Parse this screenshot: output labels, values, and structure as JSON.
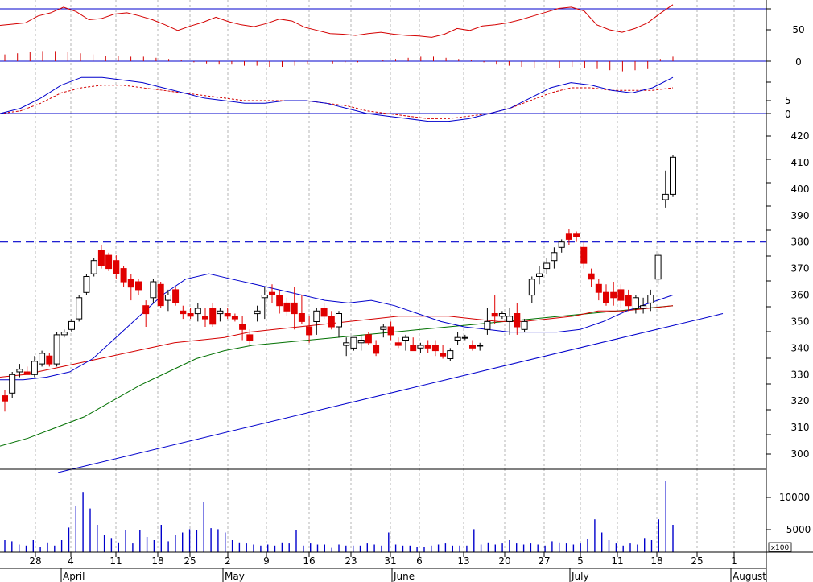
{
  "chart_data": [
    {
      "type": "line",
      "panel": "rsi",
      "yticks": [
        50,
        0
      ],
      "grid": true,
      "series": [
        {
          "color": "#d40000",
          "values": [
            57,
            59,
            61,
            72,
            77,
            86,
            79,
            66,
            68,
            75,
            77,
            72,
            66,
            58,
            49,
            56,
            62,
            70,
            63,
            58,
            55,
            60,
            67,
            64,
            54,
            49,
            44,
            43,
            41,
            44,
            46,
            43,
            41,
            40,
            38,
            43,
            52,
            49,
            56,
            58,
            61,
            66,
            72,
            78,
            84,
            86,
            80,
            58,
            50,
            46,
            52,
            61,
            76,
            90
          ]
        },
        {
          "name": "",
          "color": "#d40000",
          "bars": true,
          "values": [
            12,
            14,
            16,
            18,
            18,
            16,
            14,
            12,
            10,
            10,
            8,
            8,
            6,
            4,
            2,
            -2,
            -4,
            -6,
            -6,
            -8,
            -8,
            -10,
            -10,
            -8,
            -6,
            -4,
            -4,
            -2,
            -2,
            0,
            2,
            4,
            6,
            8,
            8,
            6,
            4,
            2,
            -2,
            -6,
            -8,
            -10,
            -12,
            -14,
            -12,
            -10,
            -12,
            -14,
            -16,
            -18,
            -16,
            -14,
            4,
            8
          ]
        }
      ]
    },
    {
      "type": "line",
      "panel": "macd",
      "yticks": [
        5,
        0
      ],
      "series": [
        {
          "color": "#0000cc",
          "values": [
            0,
            2,
            6,
            11,
            14,
            14,
            13,
            12,
            10,
            8,
            6,
            5,
            4,
            4,
            5,
            5,
            4,
            2,
            0,
            -1,
            -2,
            -3,
            -3,
            -2,
            0,
            2,
            6,
            10,
            12,
            11,
            9,
            8,
            10,
            14
          ]
        },
        {
          "color": "#d40000",
          "dashed": true,
          "values": [
            0,
            1,
            4,
            8,
            10,
            11,
            11,
            10,
            9,
            8,
            7,
            6,
            5,
            5,
            5,
            5,
            4,
            3,
            1,
            0,
            -1,
            -2,
            -2,
            -1,
            0,
            2,
            5,
            8,
            10,
            10,
            9,
            9,
            9,
            10
          ]
        }
      ]
    },
    {
      "type": "candlestick",
      "panel": "price",
      "yticks": [
        300,
        310,
        320,
        330,
        340,
        350,
        360,
        370,
        380,
        390,
        400,
        410,
        420
      ],
      "ylim": [
        294,
        424
      ],
      "reference_level": 380,
      "x_ticks": [
        "28",
        "4",
        "11",
        "18",
        "25",
        "2",
        "9",
        "16",
        "23",
        "31",
        "6",
        "13",
        "20",
        "27",
        "5",
        "11",
        "18",
        "25",
        "1"
      ],
      "x_months": [
        "April",
        "May",
        "June",
        "July",
        "August"
      ],
      "candles": [
        [
          322,
          324,
          316,
          320
        ],
        [
          323,
          331,
          321,
          330
        ],
        [
          331,
          334,
          329,
          332
        ],
        [
          331,
          333,
          330,
          330
        ],
        [
          330,
          337,
          329,
          335
        ],
        [
          334,
          339,
          333,
          338
        ],
        [
          337,
          338,
          333,
          334
        ],
        [
          334,
          346,
          333,
          345
        ],
        [
          345,
          347,
          344,
          346
        ],
        [
          347,
          351,
          346,
          350
        ],
        [
          351,
          360,
          350,
          359
        ],
        [
          361,
          368,
          360,
          367
        ],
        [
          368,
          374,
          367,
          373
        ],
        [
          377,
          379,
          370,
          371
        ],
        [
          375,
          376,
          369,
          370
        ],
        [
          373,
          375,
          366,
          368
        ],
        [
          370,
          371,
          363,
          365
        ],
        [
          366,
          368,
          358,
          363
        ],
        [
          365,
          366,
          360,
          362
        ],
        [
          356,
          358,
          348,
          353
        ],
        [
          359,
          366,
          357,
          365
        ],
        [
          364,
          365,
          355,
          356
        ],
        [
          358,
          362,
          354,
          360
        ],
        [
          362,
          363,
          356,
          357
        ],
        [
          354,
          356,
          351,
          353
        ],
        [
          353,
          355,
          351,
          352
        ],
        [
          353,
          357,
          350,
          355
        ],
        [
          352,
          355,
          348,
          351
        ],
        [
          355,
          357,
          348,
          349
        ],
        [
          353,
          355,
          350,
          354
        ],
        [
          353,
          355,
          351,
          352
        ],
        [
          352,
          353,
          350,
          351
        ],
        [
          349,
          352,
          343,
          347
        ],
        [
          345,
          347,
          341,
          343
        ],
        [
          353,
          356,
          350,
          354
        ],
        [
          359,
          363,
          351,
          360
        ],
        [
          361,
          364,
          357,
          360
        ],
        [
          360,
          362,
          353,
          356
        ],
        [
          357,
          359,
          352,
          354
        ],
        [
          357,
          363,
          347,
          353
        ],
        [
          353,
          360,
          349,
          350
        ],
        [
          348,
          352,
          342,
          345
        ],
        [
          350,
          355,
          345,
          354
        ],
        [
          355,
          357,
          351,
          352
        ],
        [
          352,
          354,
          347,
          348
        ],
        [
          348,
          354,
          344,
          353
        ],
        [
          341,
          344,
          337,
          342
        ],
        [
          340,
          344,
          339,
          344
        ],
        [
          342,
          345,
          339,
          343
        ],
        [
          345,
          346,
          341,
          342
        ],
        [
          341,
          343,
          337,
          338
        ],
        [
          347,
          349,
          344,
          348
        ],
        [
          348,
          350,
          343,
          345
        ],
        [
          342,
          344,
          340,
          341
        ],
        [
          343,
          345,
          339,
          344
        ],
        [
          341,
          344,
          339,
          339
        ],
        [
          340,
          342,
          338,
          341
        ],
        [
          341,
          343,
          338,
          340
        ],
        [
          341,
          343,
          337,
          339
        ],
        [
          338,
          341,
          336,
          337
        ],
        [
          336,
          340,
          335,
          339
        ],
        [
          343,
          346,
          341,
          344
        ],
        [
          344,
          345,
          343,
          344
        ],
        [
          341,
          343,
          339,
          340
        ],
        [
          341,
          342,
          339,
          341
        ],
        [
          347,
          355,
          345,
          350
        ],
        [
          353,
          360,
          349,
          352
        ],
        [
          352,
          354,
          351,
          353
        ],
        [
          350,
          355,
          345,
          352
        ],
        [
          353,
          357,
          345,
          348
        ],
        [
          347,
          351,
          346,
          350
        ],
        [
          360,
          367,
          357,
          366
        ],
        [
          367,
          371,
          364,
          368
        ],
        [
          370,
          374,
          368,
          372
        ],
        [
          373,
          378,
          370,
          376
        ],
        [
          378,
          381,
          376,
          380
        ],
        [
          383,
          385,
          379,
          381
        ],
        [
          383,
          384,
          380,
          382
        ],
        [
          378,
          380,
          370,
          372
        ],
        [
          368,
          370,
          363,
          366
        ],
        [
          364,
          366,
          358,
          361
        ],
        [
          361,
          364,
          356,
          357
        ],
        [
          361,
          365,
          356,
          359
        ],
        [
          362,
          364,
          355,
          358
        ],
        [
          360,
          362,
          354,
          356
        ],
        [
          355,
          360,
          353,
          359
        ],
        [
          355,
          359,
          353,
          356
        ],
        [
          357,
          362,
          354,
          360
        ],
        [
          366,
          376,
          364,
          375
        ],
        [
          396,
          407,
          393,
          398
        ],
        [
          398,
          413,
          397,
          412
        ]
      ],
      "series": [
        {
          "name": "MA blue",
          "color": "#0000cc",
          "values": [
            328,
            328,
            329,
            331,
            336,
            344,
            352,
            360,
            366,
            368,
            366,
            364,
            362,
            360,
            358,
            357,
            358,
            356,
            353,
            350,
            348,
            347,
            346,
            346,
            346,
            347,
            350,
            354,
            357,
            360
          ]
        },
        {
          "name": "MA red",
          "color": "#d40000",
          "values": [
            329,
            330,
            332,
            334,
            336,
            338,
            340,
            342,
            343,
            344,
            346,
            347,
            348,
            349,
            350,
            351,
            352,
            352,
            352,
            351,
            350,
            350,
            351,
            352,
            354,
            354,
            355,
            356
          ]
        },
        {
          "name": "MA green",
          "color": "#007000",
          "values": [
            303,
            306,
            310,
            314,
            320,
            326,
            331,
            336,
            339,
            341,
            342,
            343,
            344,
            345,
            346,
            347,
            348,
            349,
            350,
            351,
            352,
            353,
            354,
            355,
            356
          ]
        },
        {
          "name": "trendline",
          "color": "#0000cc",
          "values": [
            293,
            353
          ]
        }
      ]
    },
    {
      "type": "bar",
      "panel": "volume",
      "yticks": [
        10000,
        5000
      ],
      "unit_label": "x100",
      "color": "#0000cc",
      "values": [
        2200,
        2000,
        1400,
        1200,
        2200,
        1000,
        1800,
        1200,
        2200,
        4500,
        8500,
        11000,
        8000,
        5000,
        3200,
        2600,
        1800,
        4000,
        1600,
        4000,
        2800,
        2200,
        5000,
        2000,
        3200,
        3600,
        4200,
        4000,
        9200,
        4400,
        4200,
        3600,
        2200,
        1800,
        1600,
        1400,
        1200,
        1400,
        1200,
        1800,
        1600,
        4000,
        1200,
        1600,
        1400,
        1400,
        800,
        1400,
        1200,
        1200,
        1200,
        1600,
        1400,
        1200,
        3600,
        1400,
        1200,
        1200,
        1000,
        1000,
        1200,
        1400,
        1600,
        1200,
        1200,
        1200,
        4200,
        1400,
        1800,
        1400,
        1600,
        2200,
        1600,
        1400,
        1600,
        1400,
        1200,
        2000,
        1800,
        1600,
        1400,
        1600,
        2400,
        6000,
        3600,
        2200,
        1600,
        1200,
        1600,
        1400,
        2600,
        2200,
        6000,
        13000,
        5000
      ]
    }
  ]
}
